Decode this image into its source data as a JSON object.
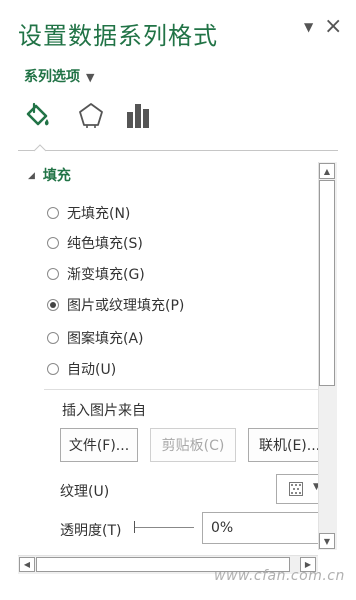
{
  "pane": {
    "title": "设置数据系列格式"
  },
  "series_options": {
    "label": "系列选项"
  },
  "tabs": [
    {
      "name": "fill-line",
      "icon": "paint-bucket-icon"
    },
    {
      "name": "effects",
      "icon": "pentagon-icon"
    },
    {
      "name": "series-options",
      "icon": "bar-chart-icon"
    }
  ],
  "fill_section": {
    "header": "填充",
    "options": [
      {
        "label": "无填充(N)",
        "selected": false
      },
      {
        "label": "纯色填充(S)",
        "selected": false
      },
      {
        "label": "渐变填充(G)",
        "selected": false
      },
      {
        "label": "图片或纹理填充(P)",
        "selected": true
      },
      {
        "label": "图案填充(A)",
        "selected": false
      },
      {
        "label": "自动(U)",
        "selected": false
      }
    ],
    "insert_from_label": "插入图片来自",
    "buttons": {
      "file": "文件(F)...",
      "clipboard": "剪贴板(C)",
      "online": "联机(E)..."
    },
    "texture_label": "纹理(U)",
    "transparency_label": "透明度(T)",
    "transparency_value": "0%"
  },
  "watermark": "www.cfan.com.cn"
}
